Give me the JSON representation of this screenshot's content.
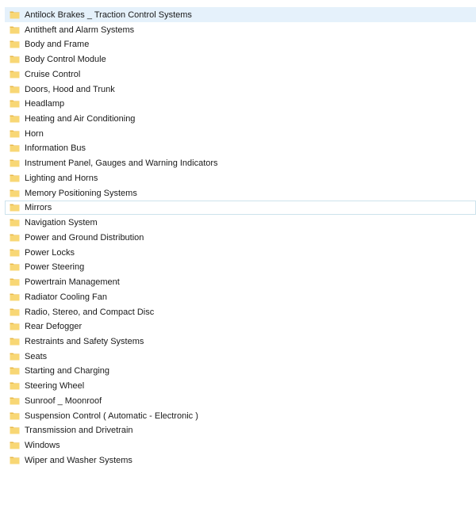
{
  "folders": [
    {
      "label": "Antilock Brakes _ Traction Control Systems",
      "state": "selected"
    },
    {
      "label": "Antitheft and Alarm Systems",
      "state": ""
    },
    {
      "label": "Body and Frame",
      "state": ""
    },
    {
      "label": "Body Control Module",
      "state": ""
    },
    {
      "label": "Cruise Control",
      "state": ""
    },
    {
      "label": "Doors, Hood and Trunk",
      "state": ""
    },
    {
      "label": "Headlamp",
      "state": ""
    },
    {
      "label": "Heating and Air Conditioning",
      "state": ""
    },
    {
      "label": "Horn",
      "state": ""
    },
    {
      "label": "Information Bus",
      "state": ""
    },
    {
      "label": "Instrument Panel, Gauges and Warning Indicators",
      "state": ""
    },
    {
      "label": "Lighting and Horns",
      "state": ""
    },
    {
      "label": "Memory Positioning Systems",
      "state": ""
    },
    {
      "label": "Mirrors",
      "state": "hovered"
    },
    {
      "label": "Navigation System",
      "state": ""
    },
    {
      "label": "Power and Ground Distribution",
      "state": ""
    },
    {
      "label": "Power Locks",
      "state": ""
    },
    {
      "label": "Power Steering",
      "state": ""
    },
    {
      "label": "Powertrain Management",
      "state": ""
    },
    {
      "label": "Radiator Cooling Fan",
      "state": ""
    },
    {
      "label": "Radio, Stereo, and Compact Disc",
      "state": ""
    },
    {
      "label": "Rear Defogger",
      "state": ""
    },
    {
      "label": "Restraints and Safety Systems",
      "state": ""
    },
    {
      "label": "Seats",
      "state": ""
    },
    {
      "label": "Starting and Charging",
      "state": ""
    },
    {
      "label": "Steering Wheel",
      "state": ""
    },
    {
      "label": "Sunroof _ Moonroof",
      "state": ""
    },
    {
      "label": "Suspension Control ( Automatic - Electronic )",
      "state": ""
    },
    {
      "label": "Transmission and Drivetrain",
      "state": ""
    },
    {
      "label": "Windows",
      "state": ""
    },
    {
      "label": "Wiper and Washer Systems",
      "state": ""
    }
  ],
  "icon": "folder-icon",
  "colors": {
    "folder_fill": "#f8d775",
    "folder_shade": "#e8b94a",
    "selected_bg": "#e5f1fb",
    "hover_border": "#cde3ec"
  }
}
